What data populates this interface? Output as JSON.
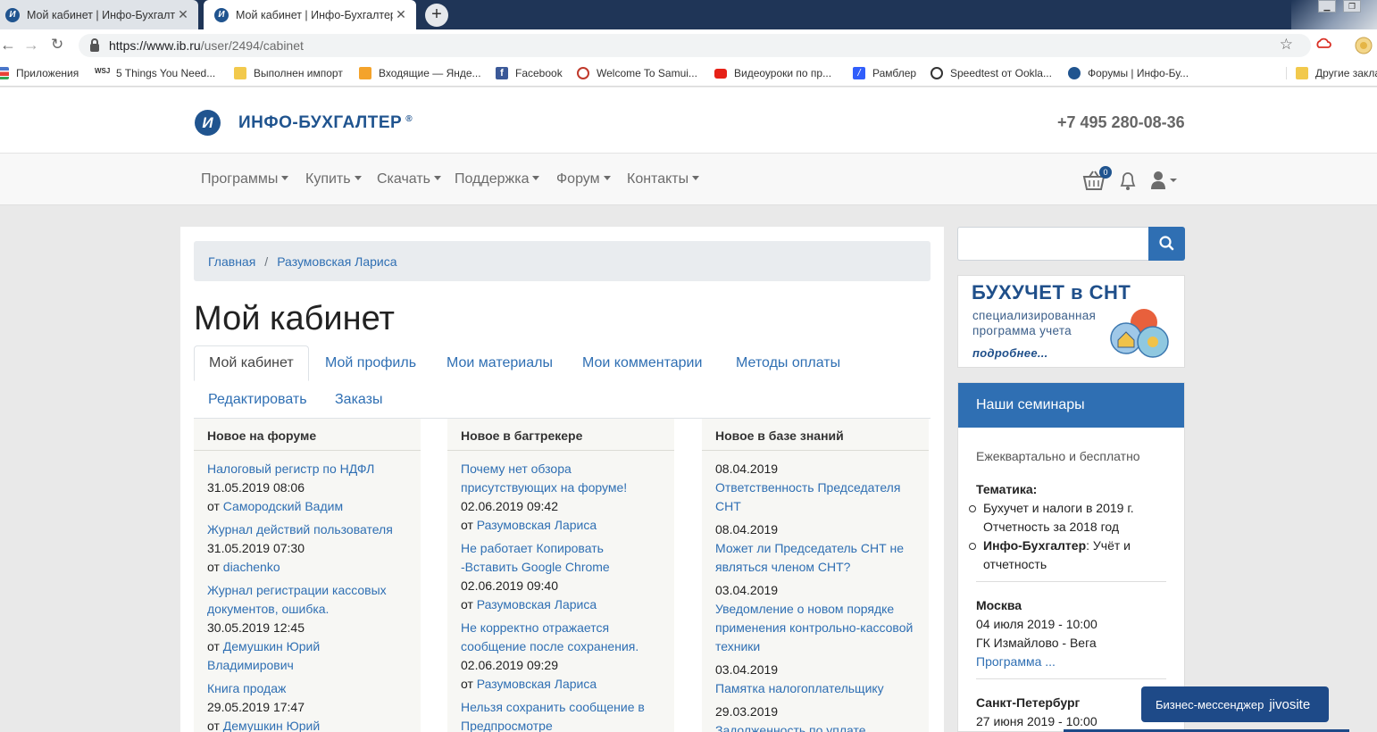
{
  "browser": {
    "tabs": [
      {
        "title": "Мой кабинет | Инфо-Бухгалтер",
        "active": false
      },
      {
        "title": "Мой кабинет | Инфо-Бухгалтер",
        "active": true
      }
    ],
    "new_tab": "+",
    "url_host": "https://www.ib.ru",
    "url_path": "/user/2494/cabinet",
    "bookmarks": [
      {
        "label": "Приложения",
        "icon": "apps-grid-icon",
        "color": "#4a76c9"
      },
      {
        "label": "5 Things You Need...",
        "icon": "wsj-icon",
        "color": "#222222"
      },
      {
        "label": "Выполнен импорт",
        "icon": "folder-icon",
        "color": "#f2c94c"
      },
      {
        "label": "Входящие — Яндe...",
        "icon": "yandex-mail-icon",
        "color": "#f4a32b"
      },
      {
        "label": "Facebook",
        "icon": "facebook-icon",
        "color": "#3b5998"
      },
      {
        "label": "Welcome To Samui...",
        "icon": "samui-icon",
        "color": "#c0392b"
      },
      {
        "label": "Видеоуроки по пр...",
        "icon": "youtube-icon",
        "color": "#e62117"
      },
      {
        "label": "Рамблер",
        "icon": "rambler-icon",
        "color": "#315efb"
      },
      {
        "label": "Speedtest от Ookla...",
        "icon": "speedtest-icon",
        "color": "#333333"
      },
      {
        "label": "Форумы | Инфо-Бу...",
        "icon": "ib-favicon-icon",
        "color": "#20548f"
      },
      {
        "label": "Другие закла",
        "icon": "folder-icon",
        "color": "#f2c94c"
      }
    ]
  },
  "site": {
    "logo_text": "ИНФО-БУХГАЛТЕР",
    "logo_mark": "®",
    "phone": "+7 495 280-08-36",
    "nav": [
      "Программы",
      "Купить",
      "Скачать",
      "Поддержка",
      "Форум",
      "Контакты"
    ],
    "cart_count": "0",
    "accent": "#2f6fb3"
  },
  "breadcrumb": {
    "home": "Главная",
    "sep": "/",
    "current": "Разумовская Лариса"
  },
  "page_title": "Мой кабинет",
  "tabs": [
    "Мой кабинет",
    "Мой профиль",
    "Мои материалы",
    "Мои комментарии",
    "Методы оплаты",
    "Редактировать",
    "Заказы"
  ],
  "columns": {
    "forum": {
      "title": "Новое на форуме",
      "entries": [
        {
          "title": "Налоговый регистр по НДФЛ",
          "date": "31.05.2019 08:06",
          "from": "от",
          "author": "Самородский Вадим"
        },
        {
          "title": "Журнал действий пользователя",
          "date": "31.05.2019 07:30",
          "from": "от",
          "author": "diachenko"
        },
        {
          "title": "Журнал регистрации кассовых документов, ошибка.",
          "date": "30.05.2019 12:45",
          "from": "от",
          "author": "Демушкин Юрий Владимирович"
        },
        {
          "title": "Книга продаж",
          "date": "29.05.2019 17:47",
          "from": "от",
          "author": "Демушкин Юрий"
        }
      ]
    },
    "bugtracker": {
      "title": "Новое в багтрекере",
      "entries": [
        {
          "title": "Почему нет обзора присутствующих на форуме!",
          "date": "02.06.2019 09:42",
          "from": "от",
          "author": "Разумовская Лариса"
        },
        {
          "title": "Не работает Копировать -Вставить Google Chrome",
          "date": "02.06.2019 09:40",
          "from": "от",
          "author": "Разумовская Лариса"
        },
        {
          "title": "Не корректно отражается сообщение после сохранения.",
          "date": "02.06.2019 09:29",
          "from": "от",
          "author": "Разумовская Лариса"
        },
        {
          "title": "Нельзя сохранить сообщение в Предпросмотре",
          "date": "",
          "from": "",
          "author": ""
        }
      ]
    },
    "knowledge": {
      "title": "Новое в базе знаний",
      "entries": [
        {
          "date": "08.04.2019",
          "title": "Ответственность Председателя СНТ"
        },
        {
          "date": "08.04.2019",
          "title": "Может ли Председатель СНТ не являться членом СНТ?"
        },
        {
          "date": "03.04.2019",
          "title": "Уведомление о новом порядке применения контрольно-кассовой техники"
        },
        {
          "date": "03.04.2019",
          "title": "Памятка налогоплательщику"
        },
        {
          "date": "29.03.2019",
          "title": "Задолженность по уплате"
        }
      ]
    }
  },
  "sidebar": {
    "banner_title": "БУХУЧЕТ в СНТ",
    "banner_sub1": "специализированная",
    "banner_sub2": "программа учета",
    "banner_more": "подробнее...",
    "seminars_title": "Наши семинары",
    "seminars_intro": "Ежеквартально и бесплатно",
    "topics_label": "Тематика:",
    "topic1": "Бухучет и налоги в 2019 г. Отчетность за 2018 год",
    "topic2_bold": "Инфо-Бухгалтер",
    "topic2_rest": ": Учёт и отчетность",
    "city1": "Москва",
    "city1_date": "04 июля 2019 - 10:00",
    "city1_place": "ГК Измайлово - Вега",
    "city1_link": "Программа ...",
    "city2": "Санкт-Петербург",
    "city2_date": "27 июня 2019 - 10:00"
  },
  "chat": {
    "label": "Бизнес-мессенджер",
    "brand": "jivosite"
  }
}
